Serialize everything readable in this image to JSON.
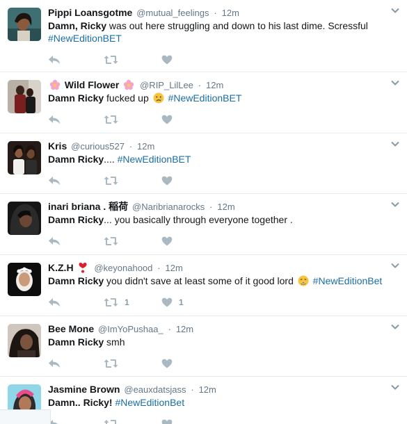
{
  "tweets": [
    {
      "fullname": "Pippi Loansgotme",
      "username": "@mutual_feelings",
      "time": "12m",
      "text_bold": "Damn, Ricky",
      "text_rest": " was out here struggling and down to his last dime. Scressful",
      "hashtag": "#NewEditionBET",
      "retweet_count": "",
      "like_count": ""
    },
    {
      "fullname": "Wild Flower",
      "username": "@RIP_LilLee",
      "time": "12m",
      "text_bold": "Damn Ricky",
      "text_rest": " fucked up",
      "hashtag": "#NewEditionBET",
      "retweet_count": "",
      "like_count": ""
    },
    {
      "fullname": "Kris",
      "username": "@curious527",
      "time": "12m",
      "text_bold": "Damn Ricky",
      "text_rest": ".... ",
      "hashtag": "#NewEditionBET",
      "retweet_count": "",
      "like_count": ""
    },
    {
      "fullname": "inari briana . 稲荷",
      "username": "@Naribrianarocks",
      "time": "12m",
      "text_bold": "Damn Ricky",
      "text_rest": "... you basically through everyone together .",
      "hashtag": "",
      "retweet_count": "",
      "like_count": ""
    },
    {
      "fullname": "K.Z.H",
      "username": "@keyonahood",
      "time": "12m",
      "text_bold": "Damn Ricky",
      "text_rest": " you didn't save at least some of it good lord",
      "hashtag": "#NewEditionBet",
      "retweet_count": "1",
      "like_count": "1"
    },
    {
      "fullname": "Bee Mone",
      "username": "@ImYoPushaa_",
      "time": "12m",
      "text_bold": "Damn Ricky",
      "text_rest": " smh",
      "hashtag": "",
      "retweet_count": "",
      "like_count": ""
    },
    {
      "fullname": "Jasmine Brown",
      "username": "@eauxdatsjass",
      "time": "12m",
      "text_bold": "Damn.. Ricky!",
      "text_rest": " ",
      "hashtag": "#NewEditionBet",
      "retweet_count": "",
      "like_count": ""
    }
  ],
  "icons": {
    "reply": "reply-icon",
    "retweet": "retweet-icon",
    "like": "heart-icon",
    "more": "chevron-down-icon"
  },
  "colors": {
    "hashtag": "#1b6ea5",
    "meta": "#657786",
    "action": "#aab8c2",
    "divider": "#e6ecf0"
  }
}
